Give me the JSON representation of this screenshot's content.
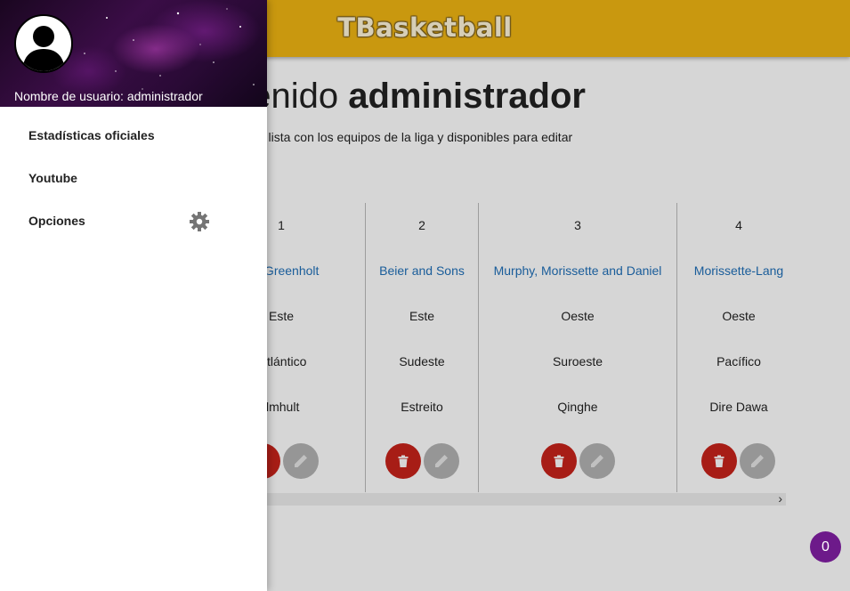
{
  "app": {
    "brand": "TBasketball"
  },
  "main": {
    "title_prefix": "nvenido",
    "title_user": "administrador",
    "subtitle": "enes una lista con los equipos de la liga y disponibles para editar"
  },
  "teams": [
    {
      "id": "1",
      "name": "e and Greenholt",
      "conference": "Este",
      "division": "tlántico",
      "city": "lmhult"
    },
    {
      "id": "2",
      "name": "Beier and Sons",
      "conference": "Este",
      "division": "Sudeste",
      "city": "Estreito"
    },
    {
      "id": "3",
      "name": "Murphy, Morissette and Daniel",
      "conference": "Oeste",
      "division": "Suroeste",
      "city": "Qinghe"
    },
    {
      "id": "4",
      "name": "Morissette-Lang",
      "conference": "Oeste",
      "division": "Pacífico",
      "city": "Dire Dawa"
    }
  ],
  "scroll": {
    "arrow": "›"
  },
  "badge": {
    "count": "0"
  },
  "drawer": {
    "username_label": "Nombre de usuario: administrador",
    "items": [
      {
        "label": "Estadísticas oficiales"
      },
      {
        "label": "Youtube"
      },
      {
        "label": "Opciones",
        "icon": "gear-icon"
      }
    ]
  },
  "colors": {
    "header": "#f0b513",
    "delete": "#c8231b",
    "edit": "#b3b3b3",
    "link": "#1f6fb8",
    "badge": "#6d1a8a"
  }
}
